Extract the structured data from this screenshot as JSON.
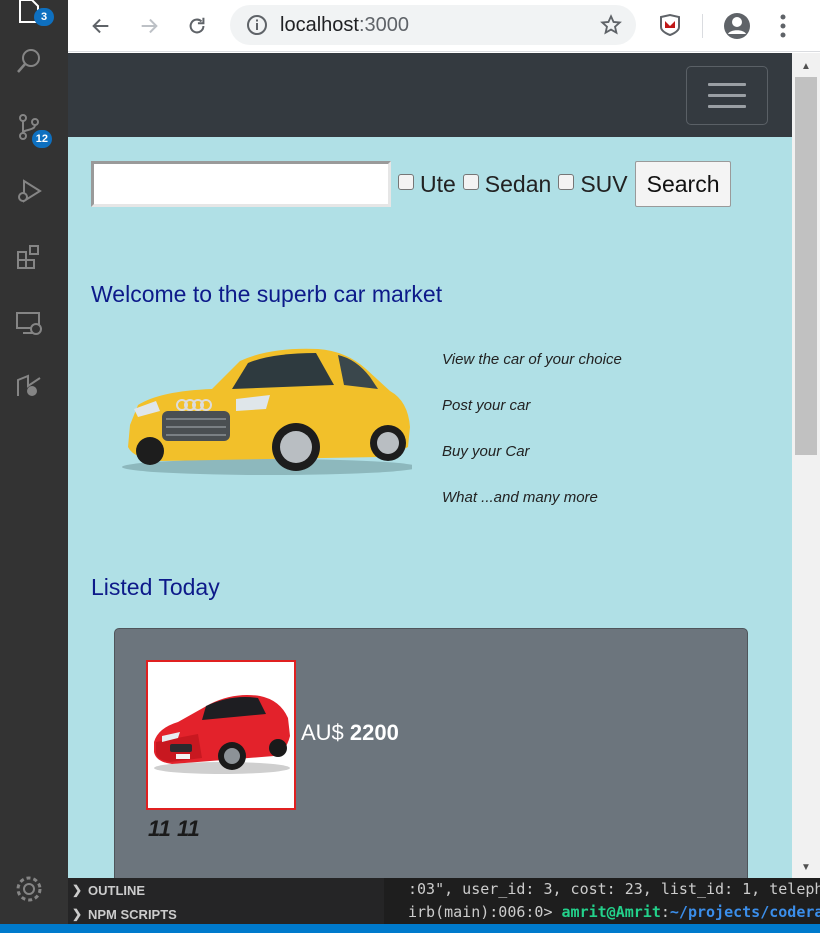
{
  "vscode": {
    "explorer_badge": "3",
    "scm_badge": "12",
    "side_sections": [
      "OUTLINE",
      "NPM SCRIPTS"
    ],
    "terminal_lines": [
      {
        "text": ":03\", user_id: 3, cost: 23, list_id: 1, teleph"
      },
      {
        "prompt": "irb(main):006:0> ",
        "user": "amrit@Amrit",
        "sep": ":",
        "path": "~/projects/codera"
      }
    ]
  },
  "browser": {
    "url_host": "localhost",
    "url_port": ":3000"
  },
  "page": {
    "search": {
      "value": "",
      "options": [
        "Ute",
        "Sedan",
        "SUV"
      ],
      "button": "Search"
    },
    "welcome": "Welcome to the superb car market",
    "features": [
      "View the car of your choice",
      "Post your car",
      "Buy your Car",
      "What ...and many more"
    ],
    "listed_heading": "Listed Today",
    "listing": {
      "currency": "AU$",
      "price": "2200",
      "title": "11 11"
    }
  },
  "colors": {
    "page_bg": "#b0e0e6",
    "navbar": "#343a40",
    "card_bg": "#6c757d",
    "heading": "#0d1a8a",
    "image_border": "#e02020"
  }
}
